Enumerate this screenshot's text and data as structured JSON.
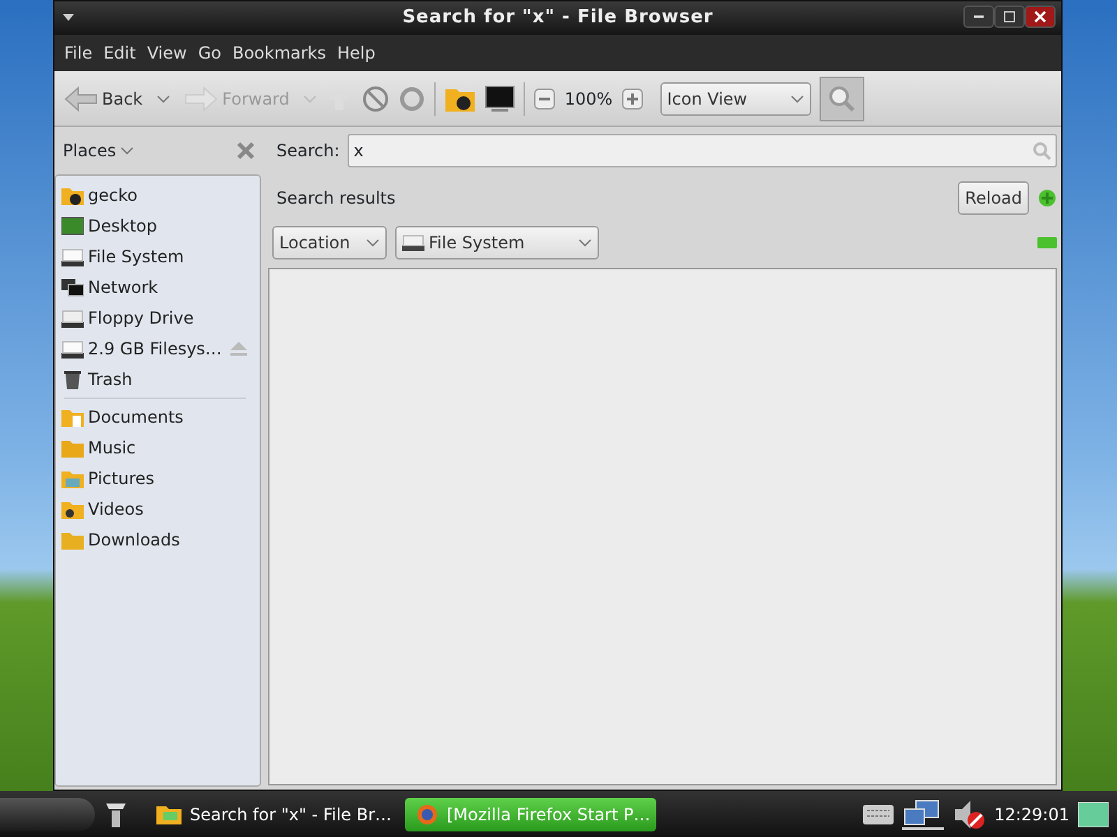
{
  "window": {
    "title": "Search for \"x\" - File Browser"
  },
  "menu": [
    "File",
    "Edit",
    "View",
    "Go",
    "Bookmarks",
    "Help"
  ],
  "toolbar": {
    "back": {
      "label": "Back",
      "disabled": false
    },
    "forward": {
      "label": "Forward",
      "disabled": true
    },
    "zoom": "100%",
    "view": "Icon View",
    "search_toggle": {
      "on": true
    }
  },
  "places": {
    "title": "Places",
    "devices": [
      {
        "label": "gecko",
        "ejectable": false
      },
      {
        "label": "Desktop",
        "ejectable": false
      },
      {
        "label": "File System",
        "ejectable": false
      },
      {
        "label": "Network",
        "ejectable": false
      },
      {
        "label": "Floppy Drive",
        "ejectable": false
      },
      {
        "label": "2.9 GB Filesys…",
        "ejectable": true
      },
      {
        "label": "Trash",
        "ejectable": false
      }
    ],
    "bookmarks": [
      {
        "label": "Documents"
      },
      {
        "label": "Music"
      },
      {
        "label": "Pictures"
      },
      {
        "label": "Videos"
      },
      {
        "label": "Downloads"
      }
    ]
  },
  "search": {
    "label": "Search:",
    "value": "x"
  },
  "results": {
    "title": "Search results",
    "reload": "Reload",
    "filter_type": "Location",
    "filter_value": "File System"
  },
  "taskbar": {
    "tasks": [
      {
        "label": "Search for \"x\" - File Br…",
        "selected": false
      },
      {
        "label": "[Mozilla Firefox Start P…",
        "selected": true
      }
    ],
    "clock": "12:29:01"
  }
}
